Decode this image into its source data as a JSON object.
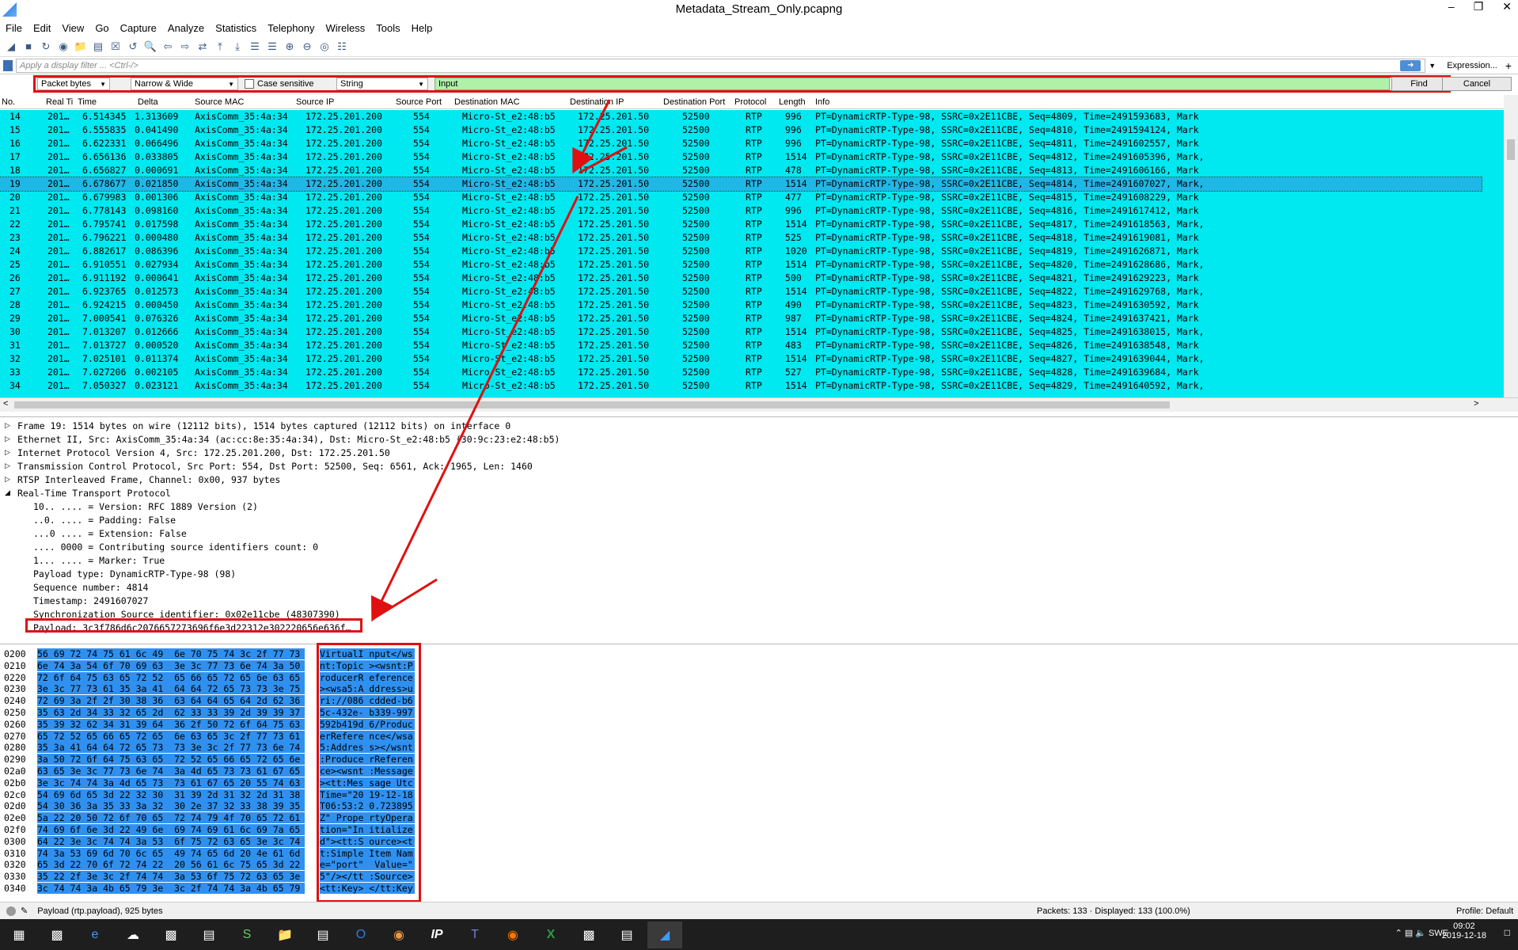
{
  "window": {
    "title": "Metadata_Stream_Only.pcapng"
  },
  "menu": [
    "File",
    "Edit",
    "View",
    "Go",
    "Capture",
    "Analyze",
    "Statistics",
    "Telephony",
    "Wireless",
    "Tools",
    "Help"
  ],
  "filter": {
    "placeholder": "Apply a display filter ... <Ctrl-/>",
    "expression_label": "Expression...",
    "plus": "+"
  },
  "find": {
    "search_in": "Packet bytes",
    "charset": "Narrow & Wide",
    "case_sensitive": "Case sensitive",
    "type": "String",
    "value": "Input",
    "find_label": "Find",
    "cancel_label": "Cancel"
  },
  "columns": [
    "No.",
    "Real Ti",
    "Time",
    "Delta",
    "Source MAC",
    "Source IP",
    "Source Port",
    "Destination MAC",
    "Destination IP",
    "Destination Port",
    "Protocol",
    "Length",
    "Info"
  ],
  "packets": [
    {
      "no": "14",
      "rt": "201…",
      "time": "6.514345",
      "delta": "1.313609",
      "smac": "AxisComm_35:4a:34",
      "sip": "172.25.201.200",
      "sport": "554",
      "dmac": "Micro-St_e2:48:b5",
      "dip": "172.25.201.50",
      "dport": "52500",
      "proto": "RTP",
      "len": "996",
      "info": "PT=DynamicRTP-Type-98, SSRC=0x2E11CBE, Seq=4809, Time=2491593683, Mark"
    },
    {
      "no": "15",
      "rt": "201…",
      "time": "6.555835",
      "delta": "0.041490",
      "smac": "AxisComm_35:4a:34",
      "sip": "172.25.201.200",
      "sport": "554",
      "dmac": "Micro-St_e2:48:b5",
      "dip": "172.25.201.50",
      "dport": "52500",
      "proto": "RTP",
      "len": "996",
      "info": "PT=DynamicRTP-Type-98, SSRC=0x2E11CBE, Seq=4810, Time=2491594124, Mark"
    },
    {
      "no": "16",
      "rt": "201…",
      "time": "6.622331",
      "delta": "0.066496",
      "smac": "AxisComm_35:4a:34",
      "sip": "172.25.201.200",
      "sport": "554",
      "dmac": "Micro-St_e2:48:b5",
      "dip": "172.25.201.50",
      "dport": "52500",
      "proto": "RTP",
      "len": "996",
      "info": "PT=DynamicRTP-Type-98, SSRC=0x2E11CBE, Seq=4811, Time=2491602557, Mark"
    },
    {
      "no": "17",
      "rt": "201…",
      "time": "6.656136",
      "delta": "0.033805",
      "smac": "AxisComm_35:4a:34",
      "sip": "172.25.201.200",
      "sport": "554",
      "dmac": "Micro-St_e2:48:b5",
      "dip": "172.25.201.50",
      "dport": "52500",
      "proto": "RTP",
      "len": "1514",
      "info": "PT=DynamicRTP-Type-98, SSRC=0x2E11CBE, Seq=4812, Time=2491605396, Mark,"
    },
    {
      "no": "18",
      "rt": "201…",
      "time": "6.656827",
      "delta": "0.000691",
      "smac": "AxisComm_35:4a:34",
      "sip": "172.25.201.200",
      "sport": "554",
      "dmac": "Micro-St_e2:48:b5",
      "dip": "172.25.201.50",
      "dport": "52500",
      "proto": "RTP",
      "len": "478",
      "info": "PT=DynamicRTP-Type-98, SSRC=0x2E11CBE, Seq=4813, Time=2491606166, Mark"
    },
    {
      "no": "19",
      "rt": "201…",
      "time": "6.678677",
      "delta": "0.021850",
      "smac": "AxisComm_35:4a:34",
      "sip": "172.25.201.200",
      "sport": "554",
      "dmac": "Micro-St_e2:48:b5",
      "dip": "172.25.201.50",
      "dport": "52500",
      "proto": "RTP",
      "len": "1514",
      "info": "PT=DynamicRTP-Type-98, SSRC=0x2E11CBE, Seq=4814, Time=2491607027, Mark,"
    },
    {
      "no": "20",
      "rt": "201…",
      "time": "6.679983",
      "delta": "0.001306",
      "smac": "AxisComm_35:4a:34",
      "sip": "172.25.201.200",
      "sport": "554",
      "dmac": "Micro-St_e2:48:b5",
      "dip": "172.25.201.50",
      "dport": "52500",
      "proto": "RTP",
      "len": "477",
      "info": "PT=DynamicRTP-Type-98, SSRC=0x2E11CBE, Seq=4815, Time=2491608229, Mark"
    },
    {
      "no": "21",
      "rt": "201…",
      "time": "6.778143",
      "delta": "0.098160",
      "smac": "AxisComm_35:4a:34",
      "sip": "172.25.201.200",
      "sport": "554",
      "dmac": "Micro-St_e2:48:b5",
      "dip": "172.25.201.50",
      "dport": "52500",
      "proto": "RTP",
      "len": "996",
      "info": "PT=DynamicRTP-Type-98, SSRC=0x2E11CBE, Seq=4816, Time=2491617412, Mark"
    },
    {
      "no": "22",
      "rt": "201…",
      "time": "6.795741",
      "delta": "0.017598",
      "smac": "AxisComm_35:4a:34",
      "sip": "172.25.201.200",
      "sport": "554",
      "dmac": "Micro-St_e2:48:b5",
      "dip": "172.25.201.50",
      "dport": "52500",
      "proto": "RTP",
      "len": "1514",
      "info": "PT=DynamicRTP-Type-98, SSRC=0x2E11CBE, Seq=4817, Time=2491618563, Mark,"
    },
    {
      "no": "23",
      "rt": "201…",
      "time": "6.796221",
      "delta": "0.000480",
      "smac": "AxisComm_35:4a:34",
      "sip": "172.25.201.200",
      "sport": "554",
      "dmac": "Micro-St_e2:48:b5",
      "dip": "172.25.201.50",
      "dport": "52500",
      "proto": "RTP",
      "len": "525",
      "info": "PT=DynamicRTP-Type-98, SSRC=0x2E11CBE, Seq=4818, Time=2491619081, Mark"
    },
    {
      "no": "24",
      "rt": "201…",
      "time": "6.882617",
      "delta": "0.086396",
      "smac": "AxisComm_35:4a:34",
      "sip": "172.25.201.200",
      "sport": "554",
      "dmac": "Micro-St_e2:48:b5",
      "dip": "172.25.201.50",
      "dport": "52500",
      "proto": "RTP",
      "len": "1020",
      "info": "PT=DynamicRTP-Type-98, SSRC=0x2E11CBE, Seq=4819, Time=2491626871, Mark"
    },
    {
      "no": "25",
      "rt": "201…",
      "time": "6.910551",
      "delta": "0.027934",
      "smac": "AxisComm_35:4a:34",
      "sip": "172.25.201.200",
      "sport": "554",
      "dmac": "Micro-St_e2:48:b5",
      "dip": "172.25.201.50",
      "dport": "52500",
      "proto": "RTP",
      "len": "1514",
      "info": "PT=DynamicRTP-Type-98, SSRC=0x2E11CBE, Seq=4820, Time=2491628686, Mark,"
    },
    {
      "no": "26",
      "rt": "201…",
      "time": "6.911192",
      "delta": "0.000641",
      "smac": "AxisComm_35:4a:34",
      "sip": "172.25.201.200",
      "sport": "554",
      "dmac": "Micro-St_e2:48:b5",
      "dip": "172.25.201.50",
      "dport": "52500",
      "proto": "RTP",
      "len": "500",
      "info": "PT=DynamicRTP-Type-98, SSRC=0x2E11CBE, Seq=4821, Time=2491629223, Mark"
    },
    {
      "no": "27",
      "rt": "201…",
      "time": "6.923765",
      "delta": "0.012573",
      "smac": "AxisComm_35:4a:34",
      "sip": "172.25.201.200",
      "sport": "554",
      "dmac": "Micro-St_e2:48:b5",
      "dip": "172.25.201.50",
      "dport": "52500",
      "proto": "RTP",
      "len": "1514",
      "info": "PT=DynamicRTP-Type-98, SSRC=0x2E11CBE, Seq=4822, Time=2491629768, Mark,"
    },
    {
      "no": "28",
      "rt": "201…",
      "time": "6.924215",
      "delta": "0.000450",
      "smac": "AxisComm_35:4a:34",
      "sip": "172.25.201.200",
      "sport": "554",
      "dmac": "Micro-St_e2:48:b5",
      "dip": "172.25.201.50",
      "dport": "52500",
      "proto": "RTP",
      "len": "490",
      "info": "PT=DynamicRTP-Type-98, SSRC=0x2E11CBE, Seq=4823, Time=2491630592, Mark"
    },
    {
      "no": "29",
      "rt": "201…",
      "time": "7.000541",
      "delta": "0.076326",
      "smac": "AxisComm_35:4a:34",
      "sip": "172.25.201.200",
      "sport": "554",
      "dmac": "Micro-St_e2:48:b5",
      "dip": "172.25.201.50",
      "dport": "52500",
      "proto": "RTP",
      "len": "987",
      "info": "PT=DynamicRTP-Type-98, SSRC=0x2E11CBE, Seq=4824, Time=2491637421, Mark"
    },
    {
      "no": "30",
      "rt": "201…",
      "time": "7.013207",
      "delta": "0.012666",
      "smac": "AxisComm_35:4a:34",
      "sip": "172.25.201.200",
      "sport": "554",
      "dmac": "Micro-St_e2:48:b5",
      "dip": "172.25.201.50",
      "dport": "52500",
      "proto": "RTP",
      "len": "1514",
      "info": "PT=DynamicRTP-Type-98, SSRC=0x2E11CBE, Seq=4825, Time=2491638015, Mark,"
    },
    {
      "no": "31",
      "rt": "201…",
      "time": "7.013727",
      "delta": "0.000520",
      "smac": "AxisComm_35:4a:34",
      "sip": "172.25.201.200",
      "sport": "554",
      "dmac": "Micro-St_e2:48:b5",
      "dip": "172.25.201.50",
      "dport": "52500",
      "proto": "RTP",
      "len": "483",
      "info": "PT=DynamicRTP-Type-98, SSRC=0x2E11CBE, Seq=4826, Time=2491638548, Mark"
    },
    {
      "no": "32",
      "rt": "201…",
      "time": "7.025101",
      "delta": "0.011374",
      "smac": "AxisComm_35:4a:34",
      "sip": "172.25.201.200",
      "sport": "554",
      "dmac": "Micro-St_e2:48:b5",
      "dip": "172.25.201.50",
      "dport": "52500",
      "proto": "RTP",
      "len": "1514",
      "info": "PT=DynamicRTP-Type-98, SSRC=0x2E11CBE, Seq=4827, Time=2491639044, Mark,"
    },
    {
      "no": "33",
      "rt": "201…",
      "time": "7.027206",
      "delta": "0.002105",
      "smac": "AxisComm_35:4a:34",
      "sip": "172.25.201.200",
      "sport": "554",
      "dmac": "Micro-St_e2:48:b5",
      "dip": "172.25.201.50",
      "dport": "52500",
      "proto": "RTP",
      "len": "527",
      "info": "PT=DynamicRTP-Type-98, SSRC=0x2E11CBE, Seq=4828, Time=2491639684, Mark"
    },
    {
      "no": "34",
      "rt": "201…",
      "time": "7.050327",
      "delta": "0.023121",
      "smac": "AxisComm_35:4a:34",
      "sip": "172.25.201.200",
      "sport": "554",
      "dmac": "Micro-St_e2:48:b5",
      "dip": "172.25.201.50",
      "dport": "52500",
      "proto": "RTP",
      "len": "1514",
      "info": "PT=DynamicRTP-Type-98, SSRC=0x2E11CBE, Seq=4829, Time=2491640592, Mark,"
    }
  ],
  "details": [
    {
      "t": "Frame 19: 1514 bytes on wire (12112 bits), 1514 bytes captured (12112 bits) on interface 0",
      "exp": "▷"
    },
    {
      "t": "Ethernet II, Src: AxisComm_35:4a:34 (ac:cc:8e:35:4a:34), Dst: Micro-St_e2:48:b5 (30:9c:23:e2:48:b5)",
      "exp": "▷"
    },
    {
      "t": "Internet Protocol Version 4, Src: 172.25.201.200, Dst: 172.25.201.50",
      "exp": "▷"
    },
    {
      "t": "Transmission Control Protocol, Src Port: 554, Dst Port: 52500, Seq: 6561, Ack: 1965, Len: 1460",
      "exp": "▷"
    },
    {
      "t": "RTSP Interleaved Frame, Channel: 0x00, 937 bytes",
      "exp": "▷"
    },
    {
      "t": "Real-Time Transport Protocol",
      "exp": "◢"
    },
    {
      "t": "10.. .... = Version: RFC 1889 Version (2)",
      "exp": ""
    },
    {
      "t": "..0. .... = Padding: False",
      "exp": ""
    },
    {
      "t": "...0 .... = Extension: False",
      "exp": ""
    },
    {
      "t": ".... 0000 = Contributing source identifiers count: 0",
      "exp": ""
    },
    {
      "t": "1... .... = Marker: True",
      "exp": ""
    },
    {
      "t": "Payload type: DynamicRTP-Type-98 (98)",
      "exp": ""
    },
    {
      "t": "Sequence number: 4814",
      "exp": ""
    },
    {
      "t": "Timestamp: 2491607027",
      "exp": ""
    },
    {
      "t": "Synchronization Source identifier: 0x02e11cbe (48307390)",
      "exp": ""
    },
    {
      "t": "Payload: 3c3f786d6c2076657273696f6e3d22312e302220656e636f…",
      "exp": ""
    }
  ],
  "bytes": [
    {
      "off": "0200",
      "hex": "56 69 72 74 75 61 6c 49  6e 70 75 74 3c 2f 77 73",
      "asc": "VirtualI nput</ws"
    },
    {
      "off": "0210",
      "hex": "6e 74 3a 54 6f 70 69 63  3e 3c 77 73 6e 74 3a 50",
      "asc": "nt:Topic ><wsnt:P"
    },
    {
      "off": "0220",
      "hex": "72 6f 64 75 63 65 72 52  65 66 65 72 65 6e 63 65",
      "asc": "roducerR eference"
    },
    {
      "off": "0230",
      "hex": "3e 3c 77 73 61 35 3a 41  64 64 72 65 73 73 3e 75",
      "asc": "><wsa5:A ddress>u"
    },
    {
      "off": "0240",
      "hex": "72 69 3a 2f 2f 30 38 36  63 64 64 65 64 2d 62 36",
      "asc": "ri://086 cdded-b6"
    },
    {
      "off": "0250",
      "hex": "35 63 2d 34 33 32 65 2d  62 33 33 39 2d 39 39 37",
      "asc": "5c-432e- b339-997"
    },
    {
      "off": "0260",
      "hex": "35 39 32 62 34 31 39 64  36 2f 50 72 6f 64 75 63",
      "asc": "592b419d 6/Produc"
    },
    {
      "off": "0270",
      "hex": "65 72 52 65 66 65 72 65  6e 63 65 3c 2f 77 73 61",
      "asc": "erRefere nce</wsa"
    },
    {
      "off": "0280",
      "hex": "35 3a 41 64 64 72 65 73  73 3e 3c 2f 77 73 6e 74",
      "asc": "5:Addres s></wsnt"
    },
    {
      "off": "0290",
      "hex": "3a 50 72 6f 64 75 63 65  72 52 65 66 65 72 65 6e",
      "asc": ":Produce rReferen"
    },
    {
      "off": "02a0",
      "hex": "63 65 3e 3c 77 73 6e 74  3a 4d 65 73 73 61 67 65",
      "asc": "ce><wsnt :Message"
    },
    {
      "off": "02b0",
      "hex": "3e 3c 74 74 3a 4d 65 73  73 61 67 65 20 55 74 63",
      "asc": "><tt:Mes sage Utc"
    },
    {
      "off": "02c0",
      "hex": "54 69 6d 65 3d 22 32 30  31 39 2d 31 32 2d 31 38",
      "asc": "Time=\"20 19-12-18"
    },
    {
      "off": "02d0",
      "hex": "54 30 36 3a 35 33 3a 32  30 2e 37 32 33 38 39 35",
      "asc": "T06:53:2 0.723895"
    },
    {
      "off": "02e0",
      "hex": "5a 22 20 50 72 6f 70 65  72 74 79 4f 70 65 72 61",
      "asc": "Z\" Prope rtyOpera"
    },
    {
      "off": "02f0",
      "hex": "74 69 6f 6e 3d 22 49 6e  69 74 69 61 6c 69 7a 65",
      "asc": "tion=\"In itialize"
    },
    {
      "off": "0300",
      "hex": "64 22 3e 3c 74 74 3a 53  6f 75 72 63 65 3e 3c 74",
      "asc": "d\"><tt:S ource><t"
    },
    {
      "off": "0310",
      "hex": "74 3a 53 69 6d 70 6c 65  49 74 65 6d 20 4e 61 6d",
      "asc": "t:Simple Item Nam"
    },
    {
      "off": "0320",
      "hex": "65 3d 22 70 6f 72 74 22  20 56 61 6c 75 65 3d 22",
      "asc": "e=\"port\"  Value=\""
    },
    {
      "off": "0330",
      "hex": "35 22 2f 3e 3c 2f 74 74  3a 53 6f 75 72 63 65 3e",
      "asc": "5\"/></tt :Source>"
    },
    {
      "off": "0340",
      "hex": "3c 74 74 3a 4b 65 79 3e  3c 2f 74 74 3a 4b 65 79",
      "asc": "<tt:Key> </tt:Key"
    }
  ],
  "status": {
    "field": "Payload (rtp.payload), 925 bytes",
    "packets": "Packets: 133 · Displayed: 133 (100.0%)",
    "profile": "Profile: Default"
  },
  "tray": {
    "lang": "SWE",
    "time": "09:02",
    "date": "2019-12-18"
  },
  "colors": {
    "packet_bg": "#00e8f0",
    "selected": "#1fb8e6",
    "highlight": "#e01010",
    "bytes_sel": "#2f90f0"
  }
}
